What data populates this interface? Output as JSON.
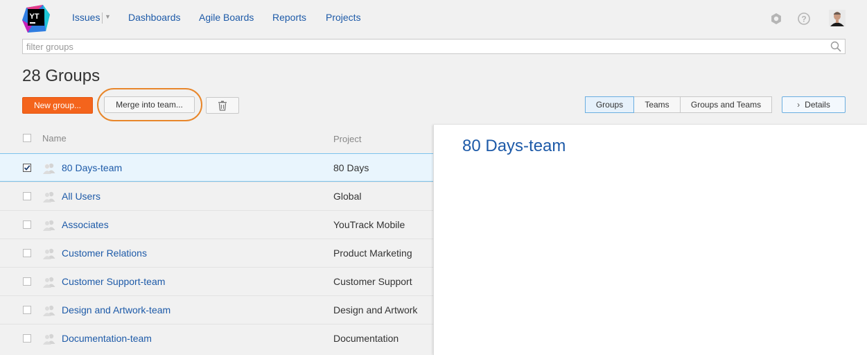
{
  "app": {
    "logo_text": "YT"
  },
  "nav": {
    "issues": "Issues",
    "dashboards": "Dashboards",
    "agile_boards": "Agile Boards",
    "reports": "Reports",
    "projects": "Projects"
  },
  "header_icons": [
    "settings-icon",
    "help-icon",
    "avatar"
  ],
  "filter": {
    "placeholder": "filter groups",
    "value": ""
  },
  "page_title": "28 Groups",
  "toolbar": {
    "new_group": "New group...",
    "merge": "Merge into team...",
    "delete_icon": "trash-icon",
    "view_tabs": [
      "Groups",
      "Teams",
      "Groups and Teams"
    ],
    "active_view": "Groups",
    "details": "Details"
  },
  "table": {
    "columns": {
      "name": "Name",
      "project": "Project"
    },
    "rows": [
      {
        "name": "80 Days-team",
        "project": "80 Days",
        "checked": true,
        "selected": true
      },
      {
        "name": "All Users",
        "project": "Global",
        "checked": false,
        "selected": false
      },
      {
        "name": "Associates",
        "project": "YouTrack Mobile",
        "checked": false,
        "selected": false
      },
      {
        "name": "Customer Relations",
        "project": "Product Marketing",
        "checked": false,
        "selected": false
      },
      {
        "name": "Customer Support-team",
        "project": "Customer Support",
        "checked": false,
        "selected": false
      },
      {
        "name": "Design and Artwork-team",
        "project": "Design and Artwork",
        "checked": false,
        "selected": false
      },
      {
        "name": "Documentation-team",
        "project": "Documentation",
        "checked": false,
        "selected": false
      }
    ]
  },
  "details_panel": {
    "title": "80 Days-team"
  },
  "colors": {
    "accent": "#f4641c",
    "link": "#1d5aa8",
    "selection": "#e9f5fd",
    "highlight_ring": "#e8862a"
  }
}
